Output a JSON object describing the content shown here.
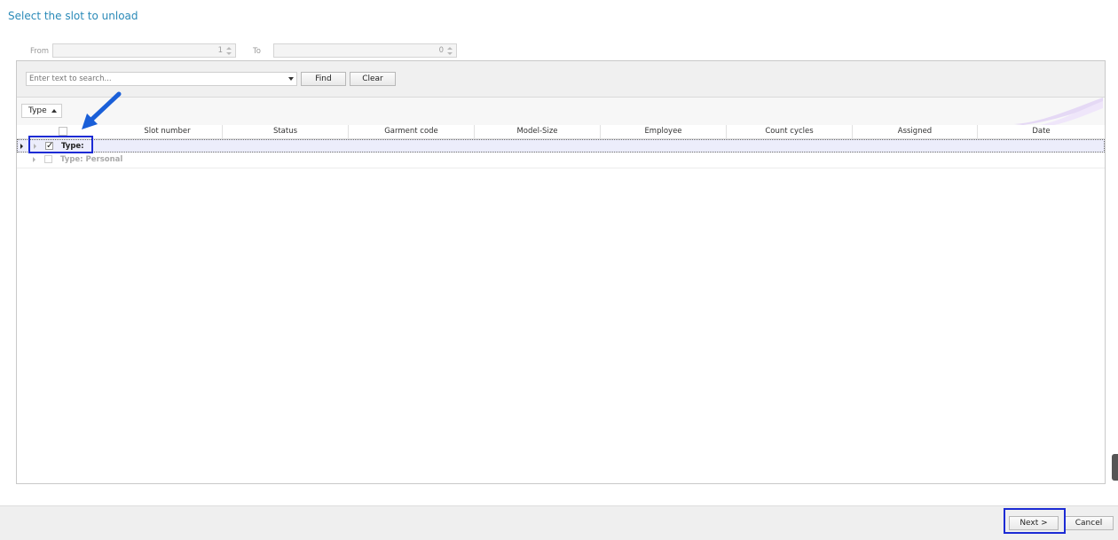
{
  "page": {
    "title": "Select the slot to unload"
  },
  "range": {
    "from_label": "From",
    "from_value": "1",
    "to_label": "To",
    "to_value": "0"
  },
  "search": {
    "placeholder": "Enter text to search...",
    "find_label": "Find",
    "clear_label": "Clear"
  },
  "grouping": {
    "chip_label": "Type"
  },
  "table": {
    "columns": [
      "Slot number",
      "Status",
      "Garment code",
      "Model-Size",
      "Employee",
      "Count cycles",
      "Assigned",
      "Date"
    ],
    "groups": [
      {
        "label": "Type:",
        "checked": true,
        "selected": true
      },
      {
        "label": "Type: Personal",
        "checked": false,
        "selected": false
      }
    ]
  },
  "footer": {
    "next_label": "Next >",
    "cancel_label": "Cancel"
  },
  "colors": {
    "accent_title": "#2a8ab8",
    "highlight_border": "#1c2bd4",
    "arrow": "#1a5fd8",
    "selected_row": "#ecedfb"
  },
  "icons": [
    "spin-up-icon",
    "spin-down-icon",
    "dropdown-arrow-icon",
    "sort-ascending-icon",
    "row-indicator-icon",
    "expand-icon",
    "checkbox-icon",
    "pointer-arrow-icon"
  ]
}
